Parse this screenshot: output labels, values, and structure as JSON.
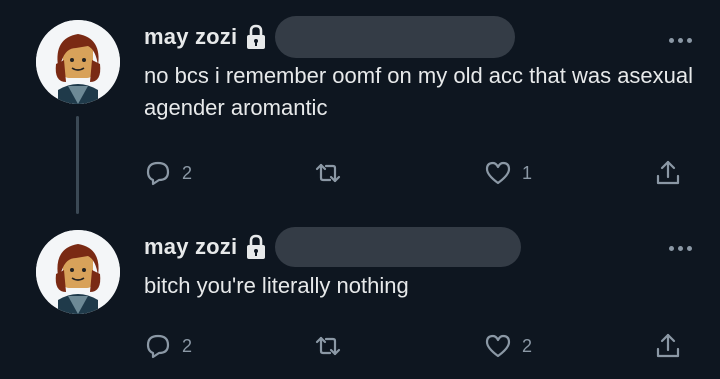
{
  "tweets": [
    {
      "author_name": "may zozi",
      "text": "no bcs i remember oomf on my old acc that was asexual agender aromantic",
      "reply_count": "2",
      "retweet_count": "",
      "like_count": "1"
    },
    {
      "author_name": "may zozi",
      "text": "bitch you're literally nothing",
      "reply_count": "2",
      "retweet_count": "",
      "like_count": "2"
    }
  ],
  "icons": {
    "reply": "reply-icon",
    "retweet": "retweet-icon",
    "like": "heart-icon",
    "share": "share-icon",
    "lock": "lock-icon",
    "more": "more-icon"
  },
  "colors": {
    "background": "#0e1620",
    "text": "#e7e9ea",
    "muted": "#8b98a5",
    "redaction": "#343c46"
  }
}
